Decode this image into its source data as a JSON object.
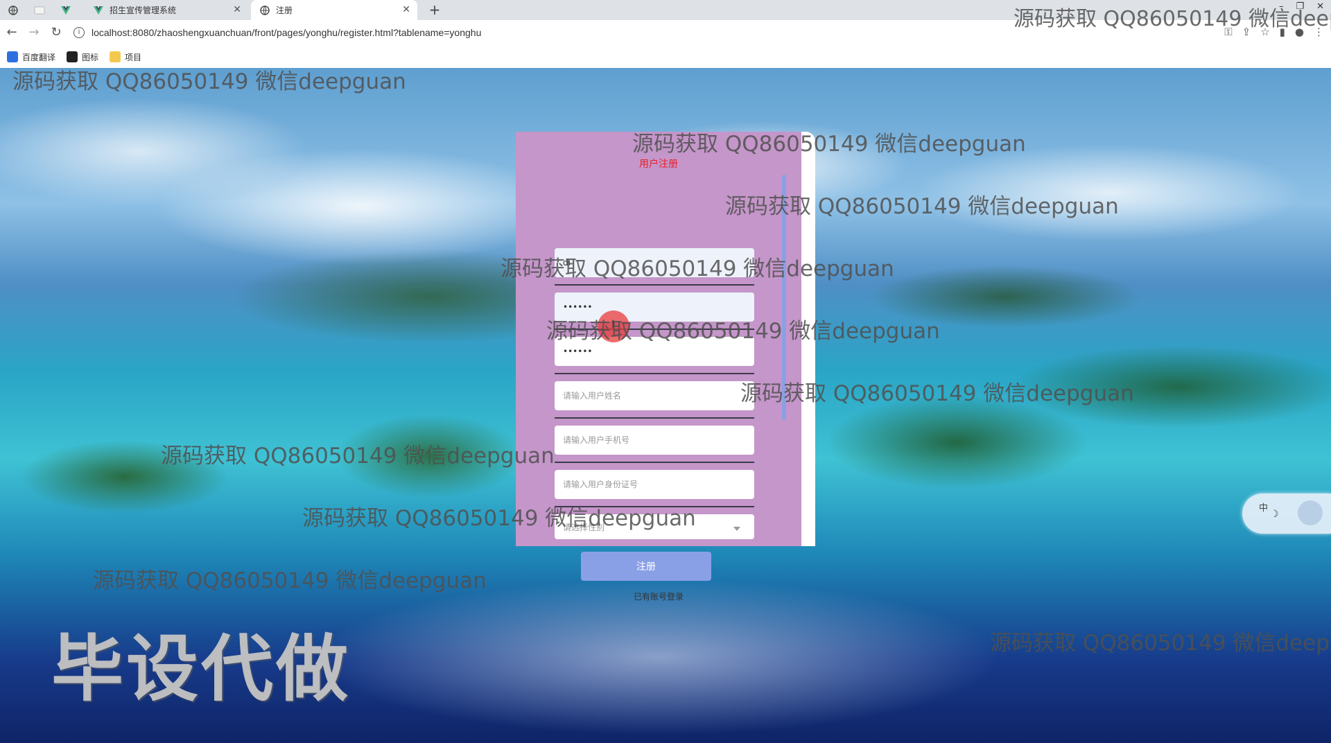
{
  "browser": {
    "tabs": [
      {
        "label": "",
        "icon": "globe-icon",
        "active": false
      },
      {
        "label": "",
        "icon": "blank-page-icon",
        "active": false
      },
      {
        "label": "",
        "icon": "vue-logo-icon",
        "active": false
      },
      {
        "label": "招生宣传管理系统",
        "icon": "vue-logo-icon",
        "active": false
      },
      {
        "label": "注册",
        "icon": "globe-icon",
        "active": true
      }
    ],
    "url": "localhost:8080/zhaoshengxuanchuan/front/pages/yonghu/register.html?tablename=yonghu",
    "bookmarks": [
      {
        "label": "百度翻译",
        "icon": "baidu-translate-icon"
      },
      {
        "label": "图标",
        "icon": "image-icon"
      },
      {
        "label": "项目",
        "icon": "folder-icon"
      }
    ]
  },
  "register": {
    "title": "用户注册",
    "account_value": "di",
    "password_value": "••••••",
    "confirm_password_value": "••••••",
    "name_placeholder": "请输入用户姓名",
    "phone_placeholder": "请输入用户手机号",
    "idcard_placeholder": "请输入用户身份证号",
    "gender_placeholder": "请选择性别",
    "submit_label": "注册",
    "login_link": "已有账号登录"
  },
  "watermarks": {
    "text": "源码获取 QQ86050149 微信deepguan",
    "clipped_text": "源码获取 QQ86050149 微信deep",
    "big_text": "毕设代做"
  },
  "ime": {
    "mode": "中"
  },
  "colors": {
    "card": "#c496c9",
    "title": "#e8202a",
    "button": "#8aa0e6"
  }
}
